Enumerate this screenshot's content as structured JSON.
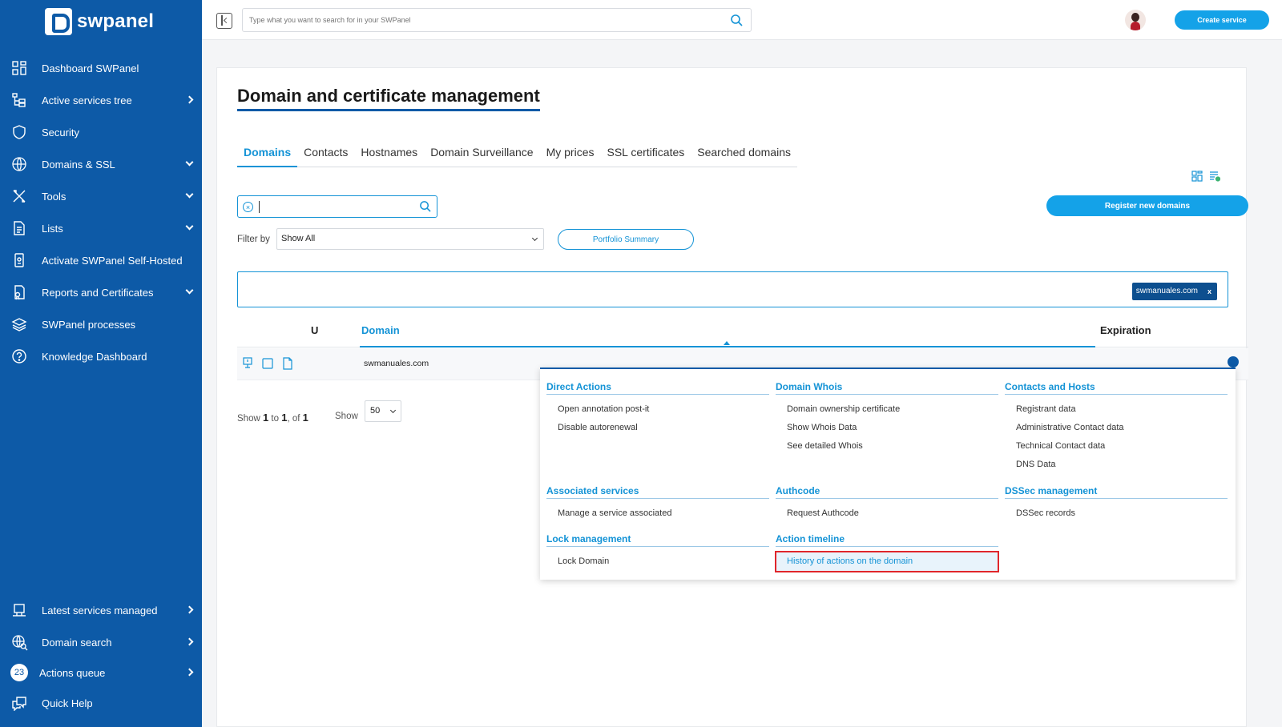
{
  "brand": {
    "name": "swpanel"
  },
  "sidebar": {
    "items": [
      {
        "label": "Dashboard SWPanel",
        "icon": "dashboard-icon",
        "arrow": ""
      },
      {
        "label": "Active services tree",
        "icon": "tree-icon",
        "arrow": "right"
      },
      {
        "label": "Security",
        "icon": "shield-icon",
        "arrow": ""
      },
      {
        "label": "Domains & SSL",
        "icon": "www-globe-icon",
        "arrow": "down"
      },
      {
        "label": "Tools",
        "icon": "tools-icon",
        "arrow": "down"
      },
      {
        "label": "Lists",
        "icon": "document-icon",
        "arrow": "down"
      },
      {
        "label": "Activate SWPanel Self-Hosted",
        "icon": "server-icon",
        "arrow": ""
      },
      {
        "label": "Reports and Certificates",
        "icon": "report-icon",
        "arrow": "down"
      },
      {
        "label": "SWPanel processes",
        "icon": "layers-icon",
        "arrow": ""
      },
      {
        "label": "Knowledge Dashboard",
        "icon": "help-circle-icon",
        "arrow": ""
      }
    ],
    "bottom_items": [
      {
        "label": "Latest services managed",
        "icon": "monitor-icon",
        "arrow": "right"
      },
      {
        "label": "Domain search",
        "icon": "globe-search-icon",
        "arrow": "right"
      },
      {
        "label": "Actions queue",
        "icon": "queue-badge-icon",
        "arrow": "right",
        "badge": "23"
      },
      {
        "label": "Quick Help",
        "icon": "chat-icon",
        "arrow": ""
      }
    ]
  },
  "topbar": {
    "search_placeholder": "Type what you want to search for in your SWPanel",
    "create_label": "Create service"
  },
  "page": {
    "title": "Domain and certificate management",
    "tabs": [
      {
        "label": "Domains",
        "active": true
      },
      {
        "label": "Contacts",
        "active": false
      },
      {
        "label": "Hostnames",
        "active": false
      },
      {
        "label": "Domain Surveillance",
        "active": false
      },
      {
        "label": "My prices",
        "active": false
      },
      {
        "label": "SSL certificates",
        "active": false
      },
      {
        "label": "Searched domains",
        "active": false
      }
    ],
    "register_label": "Register new domains",
    "filter_label": "Filter by",
    "filter_value": "Show All",
    "portfolio_label": "Portfolio Summary",
    "chip": {
      "label": "swmanuales.com",
      "close": "x"
    },
    "table": {
      "headers": {
        "u": "U",
        "domain": "Domain",
        "expiration": "Expiration"
      },
      "rows": [
        {
          "domain": "swmanuales.com"
        }
      ]
    },
    "pagination": {
      "show_prefix": "Show",
      "from": "1",
      "to_word": "to",
      "to": "1",
      "of_word": "of",
      "total": "1",
      "show_label": "Show",
      "per_page": "50"
    }
  },
  "menu": {
    "direct_actions": {
      "title": "Direct Actions",
      "items": [
        "Open annotation post-it",
        "Disable autorenewal"
      ]
    },
    "domain_whois": {
      "title": "Domain Whois",
      "items": [
        "Domain ownership certificate",
        "Show Whois Data",
        "See detailed Whois"
      ]
    },
    "contacts_hosts": {
      "title": "Contacts and Hosts",
      "items": [
        "Registrant data",
        "Administrative Contact data",
        "Technical Contact data",
        "DNS Data"
      ]
    },
    "associated_services": {
      "title": "Associated services",
      "items": [
        "Manage a service associated"
      ]
    },
    "authcode": {
      "title": "Authcode",
      "items": [
        "Request Authcode"
      ]
    },
    "dssec": {
      "title": "DSSec management",
      "items": [
        "DSSec records"
      ]
    },
    "lock": {
      "title": "Lock management",
      "items": [
        "Lock Domain"
      ]
    },
    "timeline": {
      "title": "Action timeline",
      "items": [
        "History of actions on the domain"
      ]
    }
  },
  "colors": {
    "sidebar": "#0d5aa7",
    "accent": "#1493d6",
    "button": "#14a2e8",
    "highlight": "#e0262b"
  }
}
